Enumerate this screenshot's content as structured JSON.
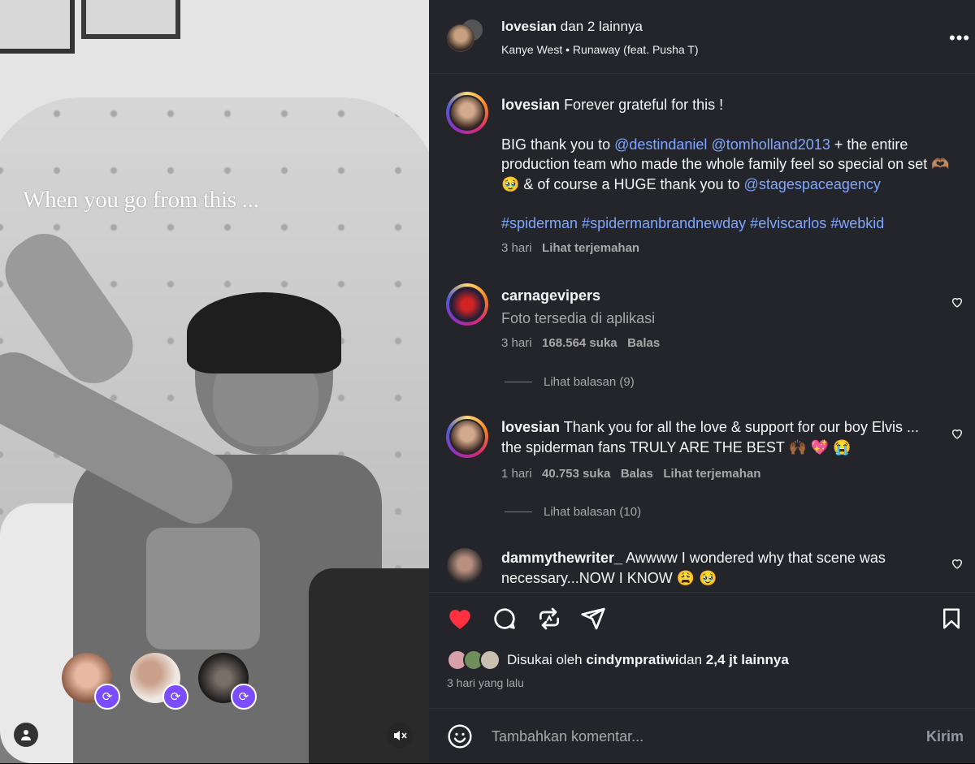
{
  "video": {
    "overlay_text": "When you go from this ..."
  },
  "header": {
    "user": "lovesian",
    "collab_text": "dan 2 lainnya",
    "artist": "Kanye West",
    "separator": "•",
    "song": "Runaway (feat. Pusha T)",
    "more": "•••"
  },
  "caption": {
    "username": "lovesian",
    "first_line": "Forever grateful for this !",
    "p1_a": "BIG thank you to ",
    "mention1": "@destindaniel",
    "mention2": "@tomholland2013",
    "p1_b": " + the entire production team who made the whole family feel so special on set 🫶🏽 🥹  & of course a HUGE thank you to ",
    "mention3": "@stagespaceagency",
    "hashtags": "#spiderman #spidermanbrandnewday #elviscarlos #webkid",
    "time": "3 hari",
    "translate": "Lihat terjemahan"
  },
  "comments": [
    {
      "username": "carnagevipers",
      "text": "Foto tersedia di aplikasi",
      "time": "3 hari",
      "likes": "168.564 suka",
      "reply": "Balas",
      "view_replies": "Lihat balasan (9)"
    },
    {
      "username": "lovesian",
      "text": "Thank you for all the love & support for our boy Elvis ... the spiderman fans TRULY ARE THE BEST 🙌🏾 💖 😭",
      "time": "1 hari",
      "likes": "40.753 suka",
      "reply": "Balas",
      "translate": "Lihat terjemahan",
      "view_replies": "Lihat balasan (10)"
    },
    {
      "username": "dammythewriter_",
      "text": "Awwww I wondered why that scene was necessary...NOW I KNOW 😩 🥹"
    }
  ],
  "likes": {
    "prefix": "Disukai oleh ",
    "user": "cindympratiwi",
    "middle": " dan ",
    "count": "2,4 jt lainnya"
  },
  "date": "3 hari yang lalu",
  "composer": {
    "placeholder": "Tambahkan komentar...",
    "send": "Kirim"
  },
  "colors": {
    "panel_bg": "#24252a",
    "link_blue": "#7fa7ff",
    "like_red": "#ff3040",
    "repost_badge": "#7c4dff"
  }
}
